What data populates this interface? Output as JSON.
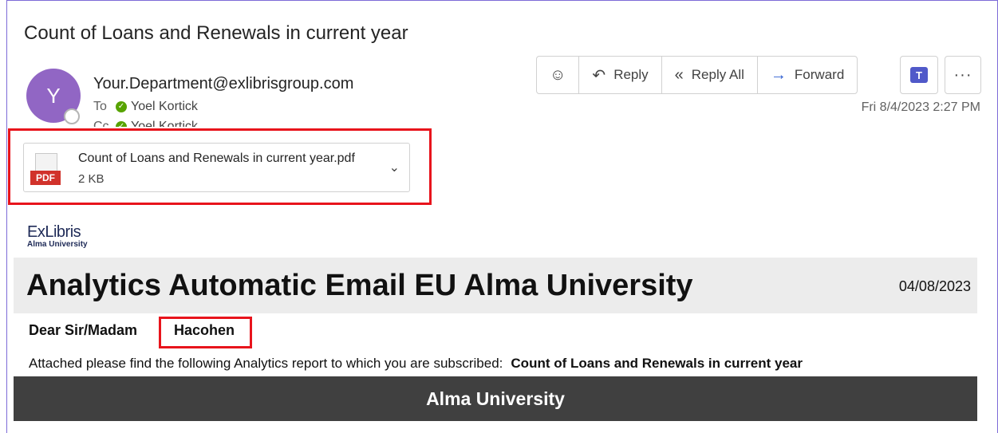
{
  "email": {
    "subject": "Count of Loans and Renewals in current year",
    "avatar_initial": "Y",
    "sender": "Your.Department@exlibrisgroup.com",
    "to_label": "To",
    "to_name": "Yoel Kortick",
    "cc_label": "Cc",
    "cc_name": "Yoel Kortick",
    "date": "Fri 8/4/2023 2:27 PM"
  },
  "toolbar": {
    "emoji_icon": "☺",
    "reply_label": "Reply",
    "reply_all_label": "Reply All",
    "forward_label": "Forward",
    "more_label": "···"
  },
  "attachment": {
    "name": "Count of Loans and Renewals in current year.pdf",
    "size": "2 KB",
    "badge": "PDF"
  },
  "body": {
    "logo_top": "ExLibris",
    "logo_bottom": "Alma University",
    "banner_title": "Analytics Automatic Email EU Alma University",
    "banner_date": "04/08/2023",
    "greeting": "Dear Sir/Madam",
    "recipient_name": "Hacohen",
    "attached_text": "Attached please find the following Analytics report to which you are subscribed:",
    "report_name": "Count of Loans and Renewals in current year",
    "footer_title": "Alma University"
  },
  "colors": {
    "accent": "#7d6bd8",
    "avatar": "#9166c4",
    "highlight": "#e8141c",
    "banner_gray": "#ececec",
    "footer_dark": "#404040"
  }
}
